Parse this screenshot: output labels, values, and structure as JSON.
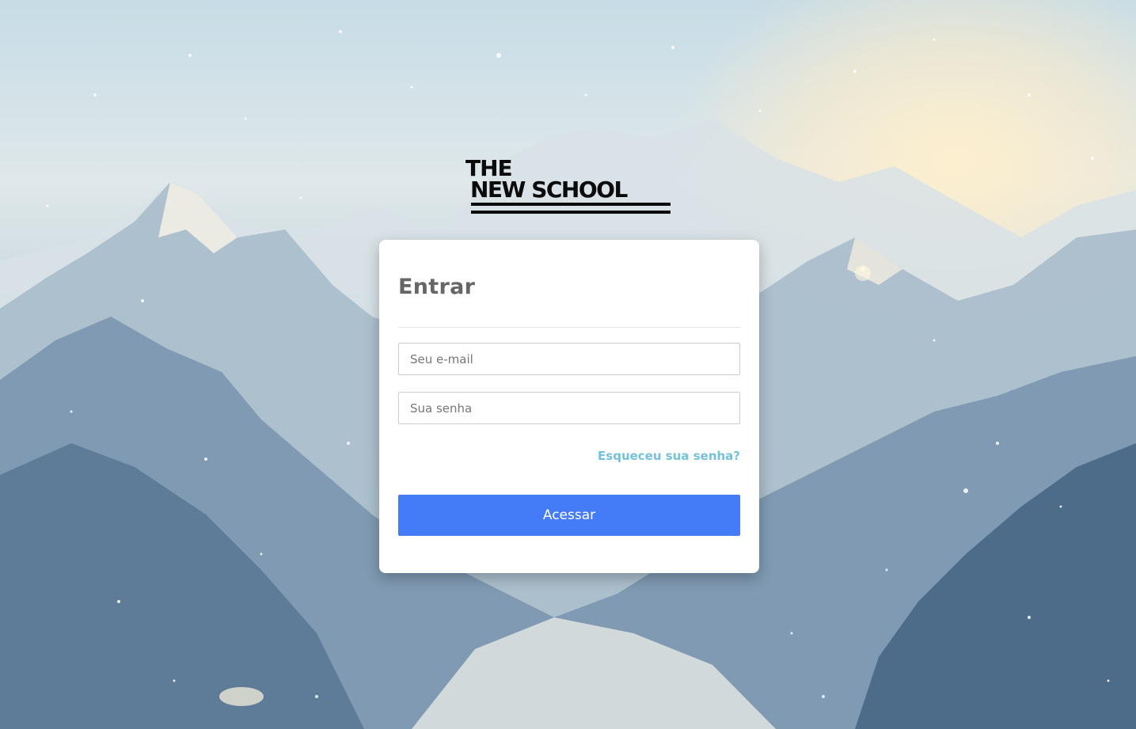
{
  "brand": {
    "logo_line1": "THE",
    "logo_line2": "NEW SCHOOL"
  },
  "login": {
    "title": "Entrar",
    "email_placeholder": "Seu e-mail",
    "password_placeholder": "Sua senha",
    "forgot_label": "Esqueceu sua senha?",
    "submit_label": "Acessar"
  },
  "colors": {
    "accent": "#447cf7",
    "link": "#74c1dc",
    "title": "#666666"
  }
}
